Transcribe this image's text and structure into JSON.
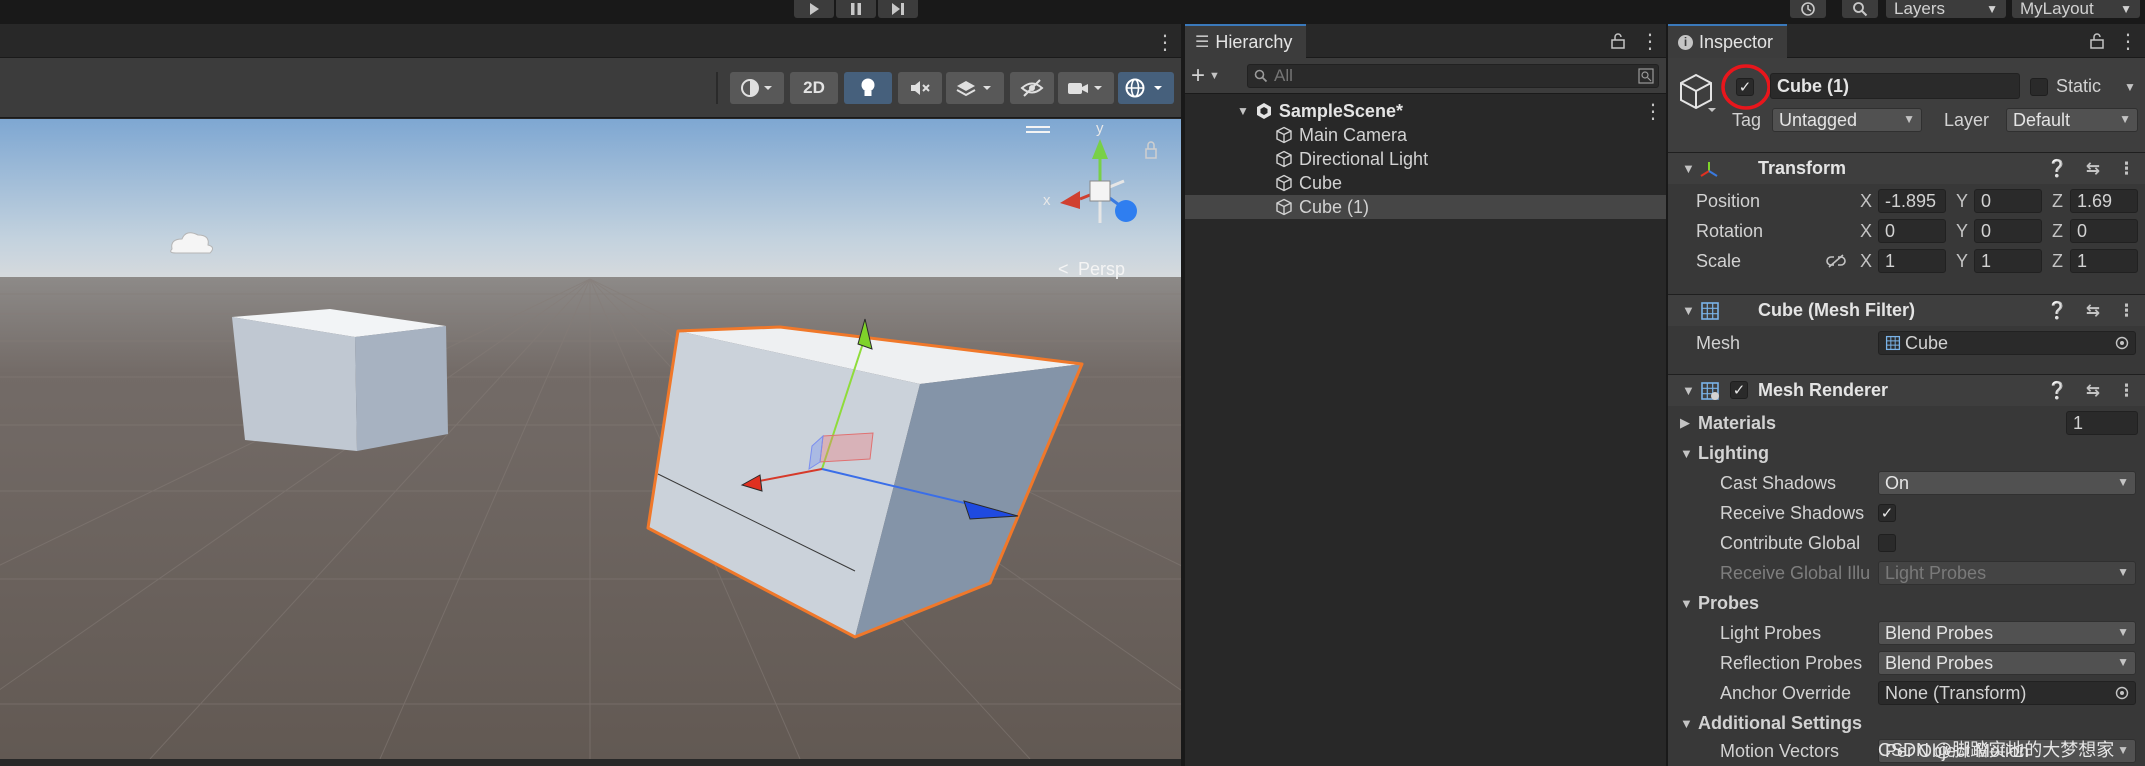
{
  "toolbar": {
    "play_icon": "play-icon",
    "pause_icon": "pause-icon",
    "step_icon": "step-icon",
    "history_icon": "history-icon",
    "search_icon": "search-icon",
    "layers_label": "Layers",
    "layout_label": "MyLayout"
  },
  "scene": {
    "mode_2d_label": "2D",
    "persp_label": "Persp",
    "gizmo_y": "y",
    "gizmo_x": "x",
    "colors": {
      "sky": "#8fb4d8",
      "ground": "#6a625e",
      "selection": "#f0782a"
    }
  },
  "hierarchy": {
    "tab_title": "Hierarchy",
    "search_placeholder": "All",
    "scene_name": "SampleScene*",
    "items": [
      {
        "label": "Main Camera"
      },
      {
        "label": "Directional Light"
      },
      {
        "label": "Cube"
      },
      {
        "label": "Cube (1)",
        "selected": true
      }
    ]
  },
  "inspector": {
    "tab_title": "Inspector",
    "object_name": "Cube (1)",
    "active": true,
    "static_label": "Static",
    "tag_label": "Tag",
    "tag_value": "Untagged",
    "layer_label": "Layer",
    "layer_value": "Default",
    "transform": {
      "title": "Transform",
      "position_label": "Position",
      "rotation_label": "Rotation",
      "scale_label": "Scale",
      "position": {
        "x": "-1.895",
        "y": "0",
        "z": "1.69"
      },
      "rotation": {
        "x": "0",
        "y": "0",
        "z": "0"
      },
      "scale": {
        "x": "1",
        "y": "1",
        "z": "1"
      }
    },
    "mesh_filter": {
      "title": "Cube (Mesh Filter)",
      "mesh_label": "Mesh",
      "mesh_value": "Cube"
    },
    "mesh_renderer": {
      "title": "Mesh Renderer",
      "materials_label": "Materials",
      "materials_count": "1",
      "lighting_label": "Lighting",
      "cast_shadows_label": "Cast Shadows",
      "cast_shadows_value": "On",
      "receive_shadows_label": "Receive Shadows",
      "contribute_gi_label": "Contribute Global",
      "receive_gi_label": "Receive Global Illu",
      "receive_gi_value": "Light Probes",
      "probes_label": "Probes",
      "light_probes_label": "Light Probes",
      "light_probes_value": "Blend Probes",
      "reflection_probes_label": "Reflection Probes",
      "reflection_probes_value": "Blend Probes",
      "anchor_override_label": "Anchor Override",
      "anchor_override_value": "None (Transform)",
      "additional_label": "Additional Settings",
      "motion_vectors_label": "Motion Vectors",
      "motion_vectors_value": "Per Object Motion"
    },
    "axis_x": "X",
    "axis_y": "Y",
    "axis_z": "Z"
  },
  "watermark": "CSDN @脚踏实地的大梦想家"
}
